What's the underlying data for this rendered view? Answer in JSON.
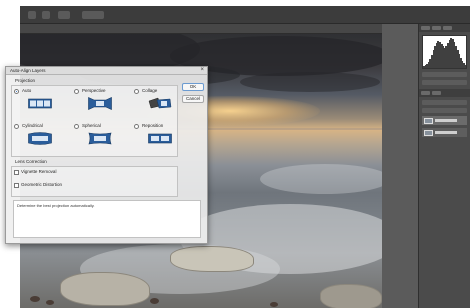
{
  "dialog": {
    "title": "Auto-Align Layers",
    "close_glyph": "×",
    "projection_label": "Projection",
    "options": [
      {
        "label": "Auto",
        "selected": true,
        "icon": "auto-projection-icon"
      },
      {
        "label": "Perspective",
        "selected": false,
        "icon": "perspective-projection-icon"
      },
      {
        "label": "Collage",
        "selected": false,
        "icon": "collage-projection-icon"
      },
      {
        "label": "Cylindrical",
        "selected": false,
        "icon": "cylindrical-projection-icon"
      },
      {
        "label": "Spherical",
        "selected": false,
        "icon": "spherical-projection-icon"
      },
      {
        "label": "Reposition",
        "selected": false,
        "icon": "reposition-projection-icon"
      }
    ],
    "ok_label": "OK",
    "cancel_label": "Cancel",
    "lens_label": "Lens Correction",
    "vignette_label": "Vignette Removal",
    "distortion_label": "Geometric Distortion",
    "message": "Determine the best projection automatically."
  },
  "colors": {
    "accent": "#1a5fb4",
    "dialog_bg": "#eeeeee",
    "app_bg": "#535353",
    "panel_bg": "#4b4b4b",
    "icon_blue": "#2a5d9b"
  }
}
